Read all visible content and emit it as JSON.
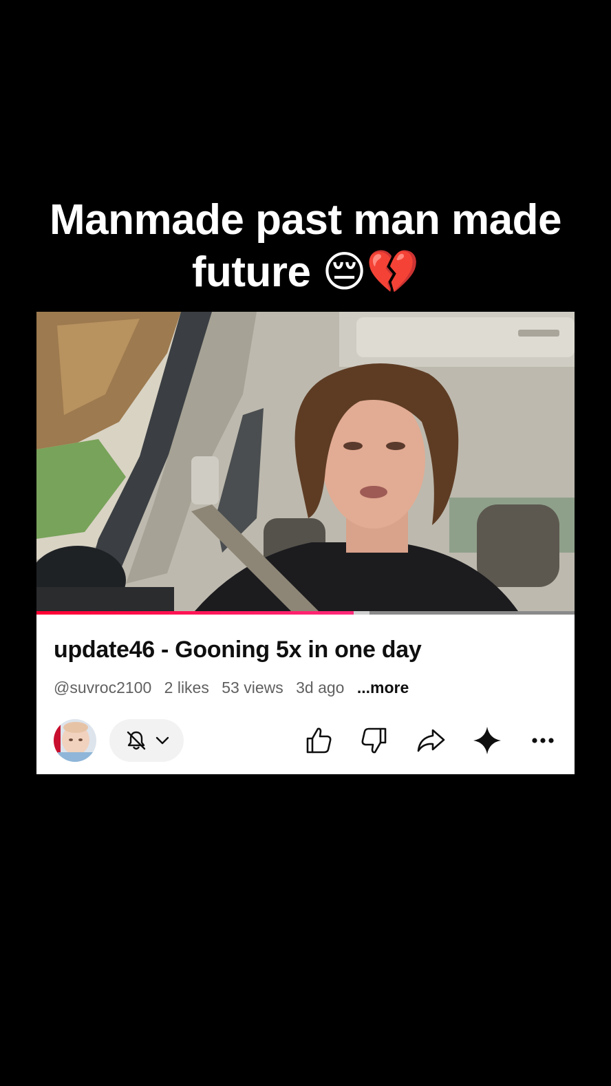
{
  "caption": {
    "line1": "Manmade past man made",
    "line2": "future 😔💔"
  },
  "video": {
    "progress": 0.59,
    "buffered": 0.62
  },
  "info": {
    "title": "update46 - Gooning 5x in one day",
    "channel": "@suvroc2100",
    "likes": "2 likes",
    "views": "53 views",
    "age": "3d ago",
    "more": "...more"
  },
  "colors": {
    "progress_accent": "#ff0033",
    "text_primary": "#0f0f0f",
    "text_secondary": "#606060"
  },
  "icons": [
    "bell-off-icon",
    "chevron-down-icon",
    "like-icon",
    "dislike-icon",
    "share-icon",
    "sparkle-icon",
    "more-icon"
  ]
}
